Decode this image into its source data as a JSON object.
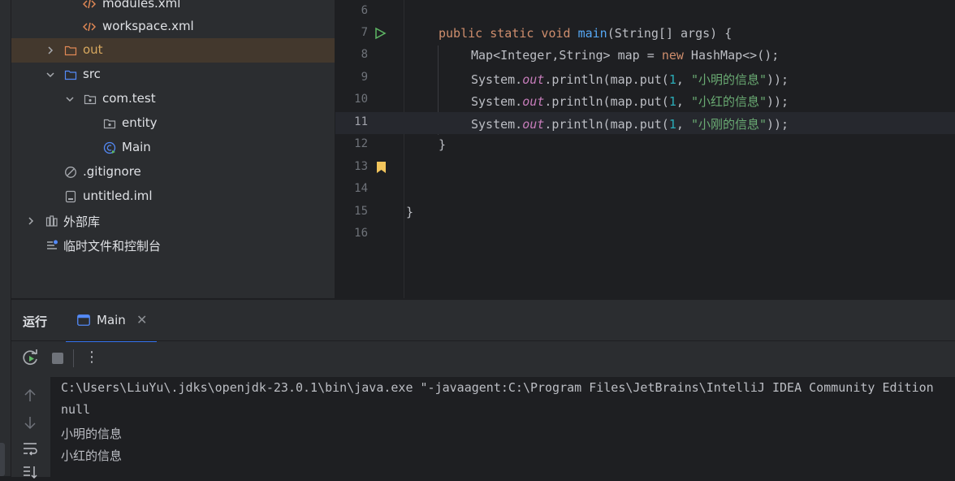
{
  "project_tree": {
    "items": [
      {
        "label": "modules.xml",
        "icon": "xml-file-icon"
      },
      {
        "label": "workspace.xml",
        "icon": "xml-file-icon"
      },
      {
        "label": "out",
        "icon": "folder-icon"
      },
      {
        "label": "src",
        "icon": "source-folder-icon"
      },
      {
        "label": "com.test",
        "icon": "package-icon"
      },
      {
        "label": "entity",
        "icon": "package-icon"
      },
      {
        "label": "Main",
        "icon": "java-class-icon"
      },
      {
        "label": ".gitignore",
        "icon": "ignore-file-icon"
      },
      {
        "label": "untitled.iml",
        "icon": "iml-file-icon"
      },
      {
        "label": "外部库",
        "icon": "library-icon"
      },
      {
        "label": "临时文件和控制台",
        "icon": "scratches-icon"
      }
    ]
  },
  "editor": {
    "line_numbers": [
      "6",
      "7",
      "8",
      "9",
      "10",
      "11",
      "12",
      "13",
      "14",
      "15",
      "16"
    ],
    "current_line": "11",
    "code": {
      "l7_kw": "public static void ",
      "l7_fn": "main",
      "l7_rest": "(String[] args) {",
      "l8_a": "Map<Integer,String> map = ",
      "l8_kw": "new",
      "l8_b": " HashMap<>();",
      "sys": "System.",
      "out": "out",
      "println": ".println(map.put(",
      "one": "1",
      "comma": ", ",
      "s1": "\"小明的信息\"",
      "s2": "\"小红的信息\"",
      "s3": "\"小刚的信息\"",
      "close": "));",
      "brace_close": "}",
      "class_close": "}"
    }
  },
  "run_panel": {
    "title": "运行",
    "tab_label": "Main",
    "close_glyph": "✕",
    "more_glyph": "⋮",
    "console_lines": [
      "C:\\Users\\LiuYu\\.jdks\\openjdk-23.0.1\\bin\\java.exe \"-javaagent:C:\\Program Files\\JetBrains\\IntelliJ IDEA Community Edition",
      "null",
      "小明的信息",
      "小红的信息"
    ]
  },
  "colors": {
    "keyword": "#cf8e6d",
    "function": "#56a8f5",
    "string": "#6aab73",
    "number": "#2aacb8",
    "static_field": "#c77dbb",
    "accent": "#3574f0",
    "run_gutter": "#5fb865",
    "bookmark": "#f2c55c",
    "folder_excluded": "#e08855"
  }
}
